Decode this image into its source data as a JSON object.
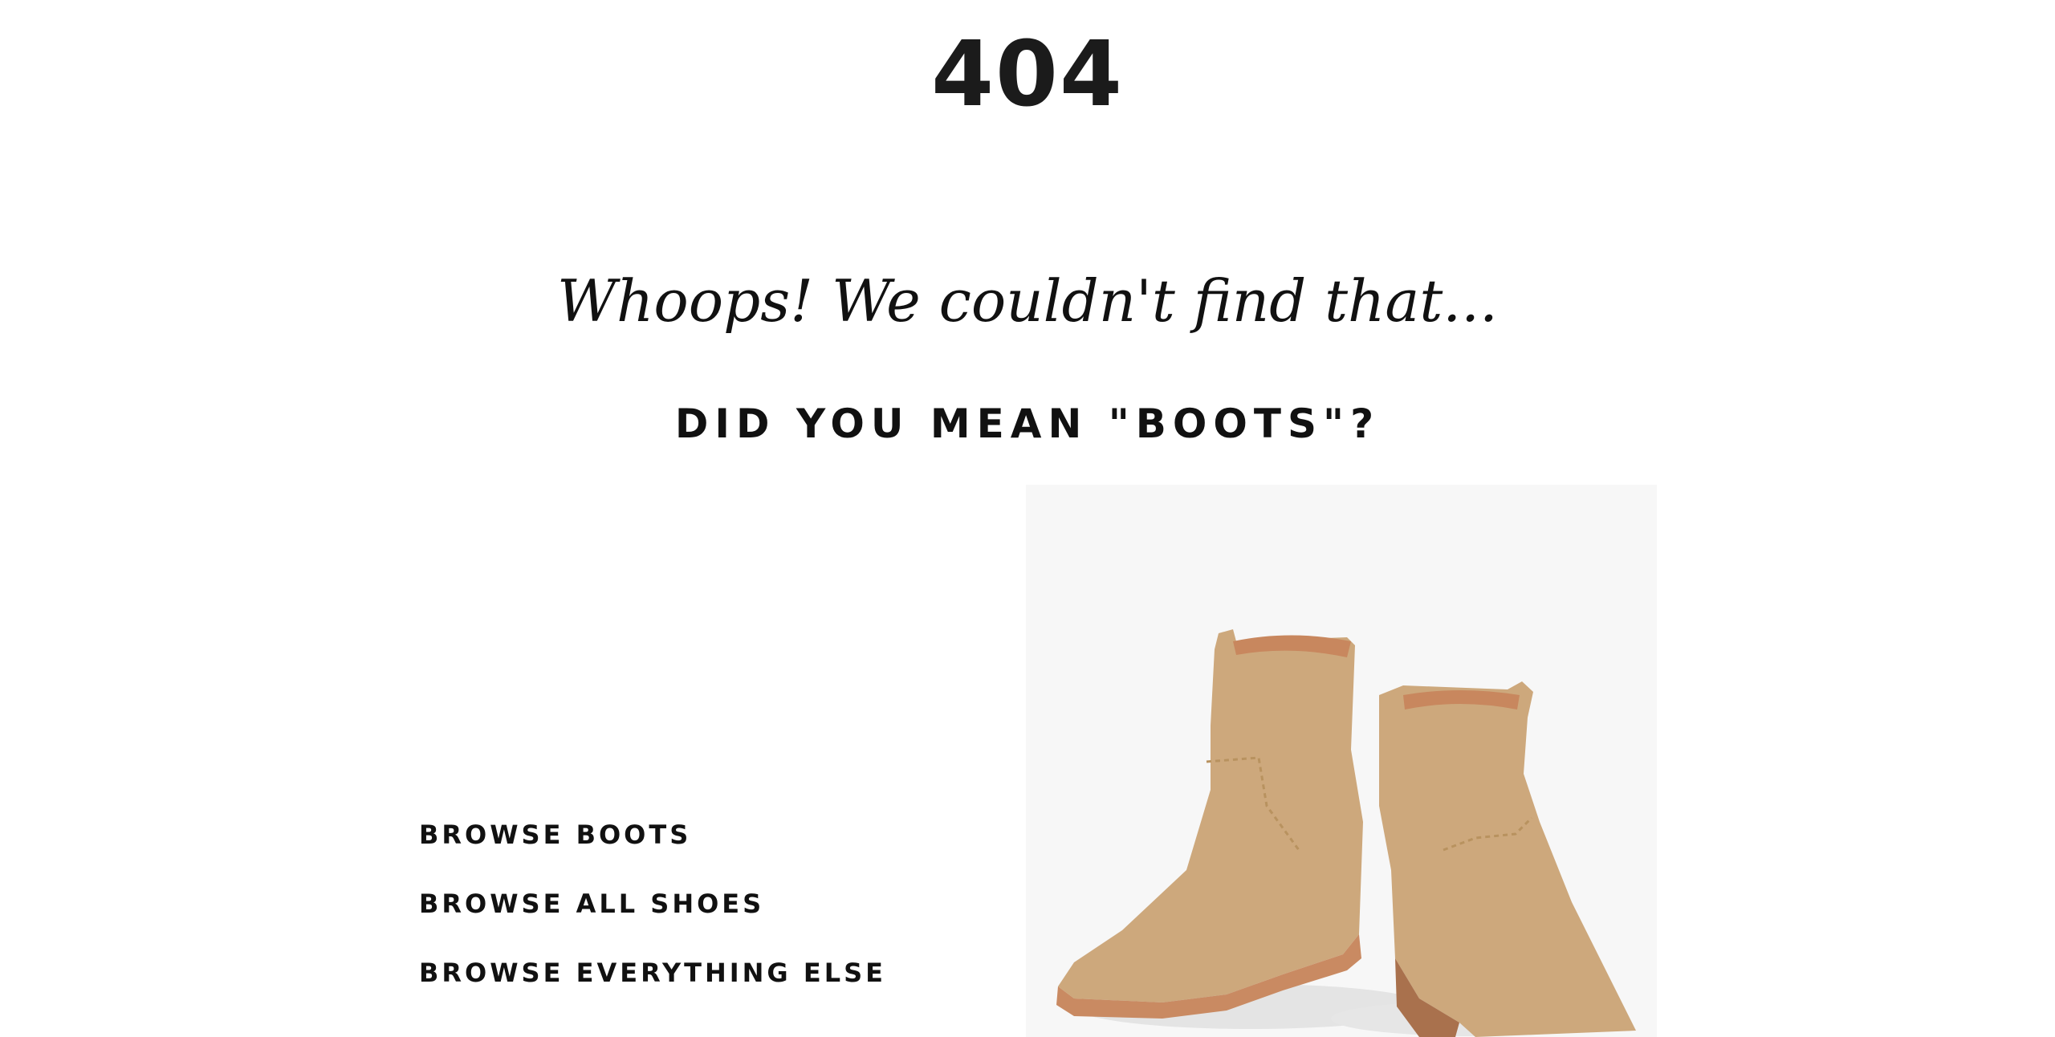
{
  "page": {
    "error_code": "404",
    "headline": "Whoops! We couldn't find that...",
    "suggestion": "DID YOU MEAN \"BOOTS\"?"
  },
  "links": [
    {
      "label": "BROWSE BOOTS"
    },
    {
      "label": "BROWSE ALL SHOES"
    },
    {
      "label": "BROWSE EVERYTHING ELSE"
    }
  ],
  "colors": {
    "text": "#111111",
    "image_background": "#f7f7f7",
    "boot_suede": "#cda87c",
    "boot_sole": "#c98a62"
  }
}
